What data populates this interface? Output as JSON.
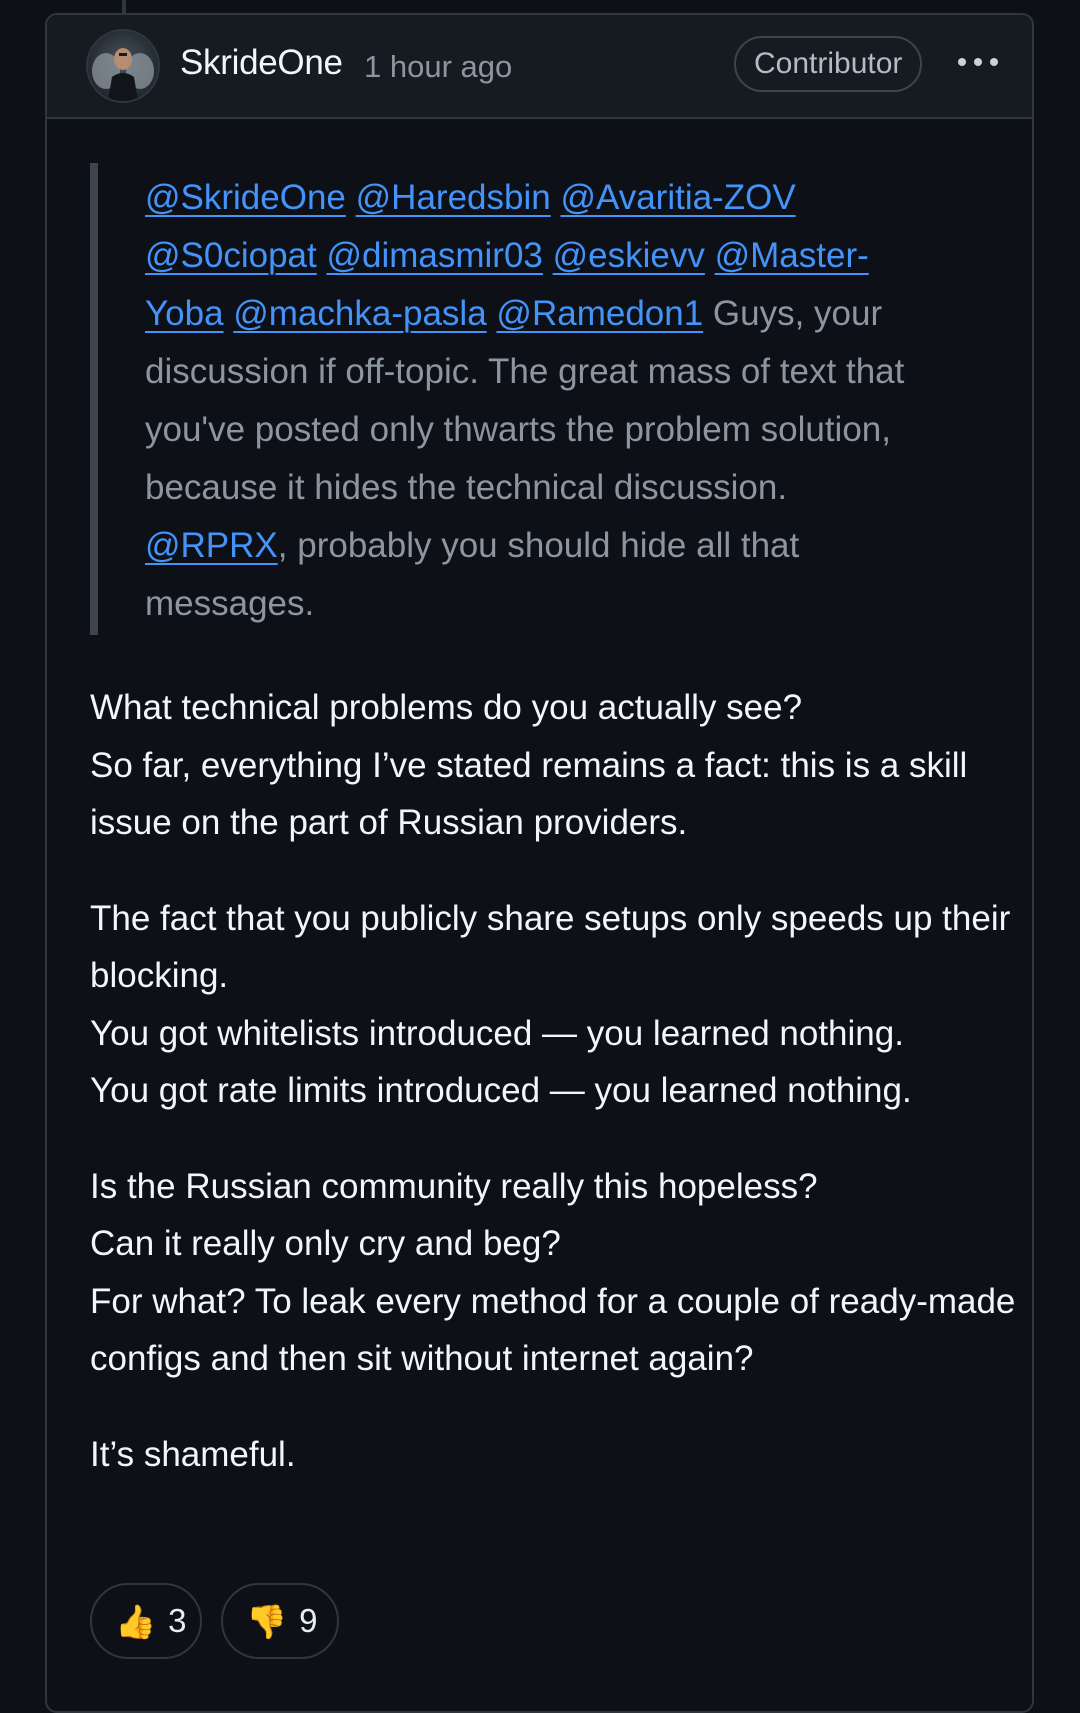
{
  "comment": {
    "author": "SkrideOne",
    "timestamp": "1 hour ago",
    "role_badge": "Contributor",
    "menu_icon": "kebab-menu-icon",
    "quote": {
      "mentions": [
        "@SkrideOne",
        "@Haredsbin",
        "@Avaritia-ZOV",
        "@S0ciopat",
        "@dimasmir03",
        "@eskievv",
        "@Master-Yoba",
        "@machka-pasla",
        "@Ramedon1"
      ],
      "text_1": "Guys, your discussion if off-topic. The great mass of text that you've posted only thwarts the problem solution, because it hides the technical discussion.",
      "mention_rprx": "@RPRX",
      "text_2": ", probably you should hide all that messages."
    },
    "paragraphs": [
      [
        "What technical problems do you actually see?",
        "So far, everything I’ve stated remains a fact: this is a skill issue on the part of Russian providers."
      ],
      [
        "The fact that you publicly share setups only speeds up their blocking.",
        "You got whitelists introduced — you learned nothing.",
        "You got rate limits introduced — you learned nothing."
      ],
      [
        "Is the Russian community really this hopeless?",
        "Can it really only cry and beg?",
        "For what? To leak every method for a couple of ready-made configs and then sit without internet again?"
      ],
      [
        "It’s shameful."
      ]
    ],
    "reactions": [
      {
        "icon": "thumbs-up-icon",
        "emoji": "👍",
        "count": "3"
      },
      {
        "icon": "thumbs-down-icon",
        "emoji": "👎",
        "count": "9"
      }
    ]
  }
}
